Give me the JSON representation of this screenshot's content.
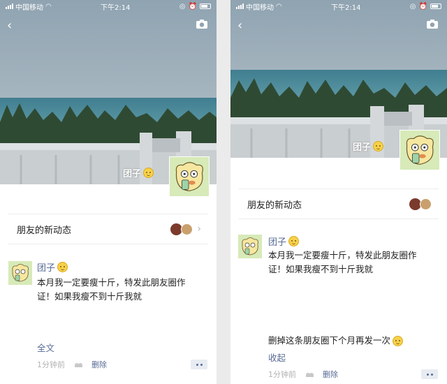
{
  "status_bar": {
    "carrier": "中国移动",
    "time": "下午2:14"
  },
  "profile": {
    "name": "团子"
  },
  "notification": {
    "label": "朋友的新动态"
  },
  "post": {
    "author": "团子",
    "text_line1": "本月我一定要瘦十斤，特发此朋友圈作",
    "text_line2": "证！如果我瘦不到十斤我就",
    "text_extra": "删掉这条朋友圈下个月再发一次",
    "expand_label": "全文",
    "collapse_label": "收起",
    "time": "1分钟前",
    "delete_label": "删除"
  },
  "colors": {
    "link": "#576b95",
    "meta": "#b2b2b2",
    "avatar_bg": "#d7eab8"
  }
}
